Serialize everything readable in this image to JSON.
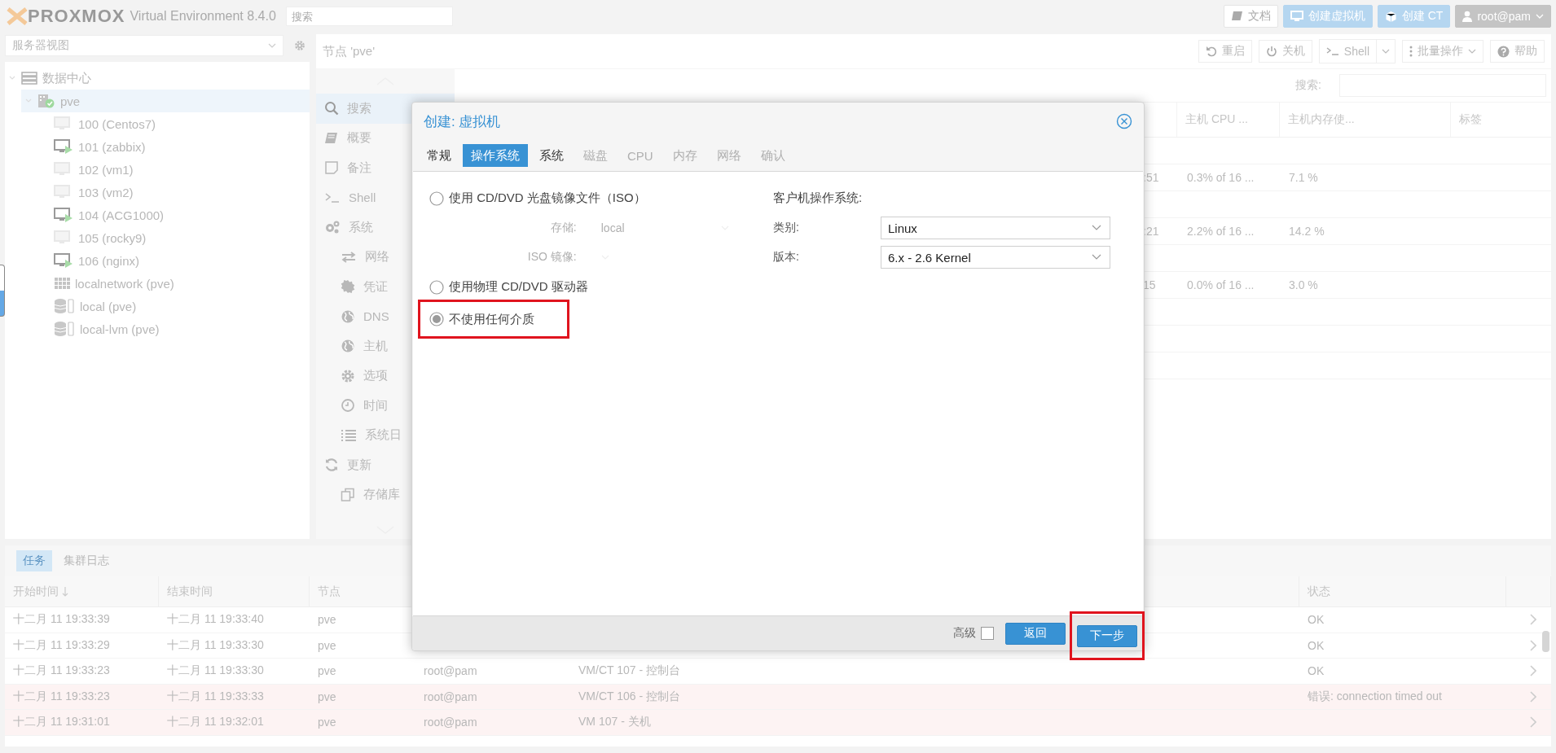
{
  "topbar": {
    "logo": "PROXMOX",
    "product": "Virtual Environment 8.4.0",
    "search": {
      "placeholder": "搜索"
    },
    "buttons": [
      {
        "kind": "docs",
        "label": "文档"
      },
      {
        "kind": "vm",
        "label": "创建虚拟机"
      },
      {
        "kind": "ct",
        "label": "创建 CT"
      },
      {
        "kind": "user",
        "label": "root@pam"
      }
    ]
  },
  "sidebar": {
    "view": "服务器视图",
    "tree": [
      {
        "label": "数据中心",
        "kind": "datacenter",
        "selected": false,
        "expanded": true,
        "children": [
          {
            "label": "pve",
            "kind": "node",
            "selected": true,
            "expanded": true,
            "children": [
              {
                "label": "100 (Centos7)",
                "kind": "vm",
                "running": false,
                "selected": false
              },
              {
                "label": "101 (zabbix)",
                "kind": "vm",
                "running": true,
                "selected": false
              },
              {
                "label": "102 (vm1)",
                "kind": "vm",
                "running": false,
                "selected": false
              },
              {
                "label": "103 (vm2)",
                "kind": "vm",
                "running": false,
                "selected": false
              },
              {
                "label": "104 (ACG1000)",
                "kind": "vm",
                "running": true,
                "selected": false
              },
              {
                "label": "105 (rocky9)",
                "kind": "vm",
                "running": false,
                "selected": false
              },
              {
                "label": "106 (nginx)",
                "kind": "vm",
                "running": true,
                "selected": false
              },
              {
                "label": "localnetwork (pve)",
                "kind": "sdn",
                "selected": false
              },
              {
                "label": "local (pve)",
                "kind": "storage",
                "selected": false
              },
              {
                "label": "local-lvm (pve)",
                "kind": "storage",
                "selected": false
              }
            ]
          }
        ]
      }
    ]
  },
  "node_panel": {
    "title": "节点 'pve'",
    "toolbar": [
      {
        "kind": "reboot",
        "label": "重启"
      },
      {
        "kind": "shutdown",
        "label": "关机"
      },
      {
        "kind": "shell",
        "label": "Shell"
      },
      {
        "kind": "bulk",
        "label": "批量操作"
      },
      {
        "kind": "help",
        "label": "帮助"
      }
    ],
    "nav": [
      {
        "kind": "search",
        "label": "搜索",
        "selected": true
      },
      {
        "kind": "summary",
        "label": "概要",
        "selected": false
      },
      {
        "kind": "notes",
        "label": "备注",
        "selected": false
      },
      {
        "kind": "shell",
        "label": "Shell",
        "selected": false
      },
      {
        "kind": "system",
        "label": "系统",
        "selected": false,
        "children": [
          {
            "kind": "network",
            "label": "网络",
            "selected": false
          },
          {
            "kind": "cert",
            "label": "凭证",
            "selected": false
          },
          {
            "kind": "globe",
            "label": "DNS",
            "selected": false
          },
          {
            "kind": "globe",
            "label": "主机",
            "selected": false
          },
          {
            "kind": "gear",
            "label": "选项",
            "selected": false
          },
          {
            "kind": "clock",
            "label": "时间",
            "selected": false
          },
          {
            "kind": "list",
            "label": "系统日",
            "selected": false
          }
        ]
      },
      {
        "kind": "refresh",
        "label": "更新",
        "selected": false,
        "children": [
          {
            "kind": "repo",
            "label": "存储库",
            "selected": false
          }
        ]
      }
    ],
    "grid": {
      "search_label": "搜索:",
      "columns": [
        "主机 CPU ...",
        "主机内存使...",
        "标签"
      ],
      "rows": [
        {
          "column_1": ":51",
          "cells": [
            "0.3% of 16 ...",
            "7.1 %"
          ]
        },
        {
          "column_1": ":21",
          "cells": [
            "2.2% of 16 ...",
            "14.2 %"
          ]
        },
        {
          "column_1": "15",
          "cells": [
            "0.0% of 16 ...",
            "3.0 %"
          ]
        }
      ]
    }
  },
  "dialog": {
    "title": "创建: 虚拟机",
    "tabs": [
      {
        "label": "常规",
        "selected": false,
        "disabled": false
      },
      {
        "label": "操作系统",
        "selected": true,
        "disabled": false
      },
      {
        "label": "系统",
        "selected": false,
        "disabled": false
      },
      {
        "label": "磁盘",
        "selected": false,
        "disabled": true
      },
      {
        "label": "CPU",
        "selected": false,
        "disabled": true
      },
      {
        "label": "内存",
        "selected": false,
        "disabled": true
      },
      {
        "label": "网络",
        "selected": false,
        "disabled": true
      },
      {
        "label": "确认",
        "selected": false,
        "disabled": true
      }
    ],
    "media": [
      {
        "label": "使用 CD/DVD 光盘镜像文件（ISO）",
        "selected": false,
        "highlighted": false,
        "fields": [
          {
            "label": "存储:",
            "value": "local"
          },
          {
            "label": "ISO 镜像:"
          }
        ]
      },
      {
        "label": "使用物理 CD/DVD 驱动器",
        "selected": false,
        "highlighted": false
      },
      {
        "label": "不使用任何介质",
        "selected": true,
        "highlighted": true
      }
    ],
    "guest_os": {
      "heading": "客户机操作系统:",
      "fields": [
        {
          "label": "类别:",
          "value": "Linux"
        },
        {
          "label": "版本:",
          "value": "6.x - 2.6 Kernel"
        }
      ]
    },
    "advanced": {
      "label": "高级",
      "checked": false
    },
    "buttons": [
      {
        "label": "返回",
        "highlighted": false
      },
      {
        "label": "下一步",
        "highlighted": true
      }
    ]
  },
  "tasks": {
    "tabs": [
      {
        "label": "任务",
        "selected": true
      },
      {
        "label": "集群日志",
        "selected": false
      }
    ],
    "columns": [
      {
        "label": "开始时间",
        "sorted": true
      },
      {
        "label": "结束时间",
        "sorted": false
      },
      {
        "label": "节点",
        "sorted": false
      },
      {},
      {},
      {
        "label": "状态",
        "sorted": false
      }
    ],
    "rows": [
      {
        "start": "十二月 11 19:33:39",
        "end": "十二月 11 19:33:40",
        "node": "pve",
        "status": "OK",
        "error": false
      },
      {
        "start": "十二月 11 19:33:29",
        "end": "十二月 11 19:33:30",
        "node": "pve",
        "status": "OK",
        "error": false
      },
      {
        "start": "十二月 11 19:33:23",
        "end": "十二月 11 19:33:30",
        "node": "pve",
        "user": "root@pam",
        "desc": "VM/CT 107 - 控制台",
        "status": "OK",
        "error": false
      },
      {
        "start": "十二月 11 19:33:23",
        "end": "十二月 11 19:33:33",
        "node": "pve",
        "user": "root@pam",
        "desc": "VM/CT 106 - 控制台",
        "status": "错误: connection timed out",
        "error": true
      },
      {
        "start": "十二月 11 19:31:01",
        "end": "十二月 11 19:32:01",
        "node": "pve",
        "user": "root@pam",
        "desc": "VM 107 - 关机",
        "error": true
      }
    ]
  }
}
